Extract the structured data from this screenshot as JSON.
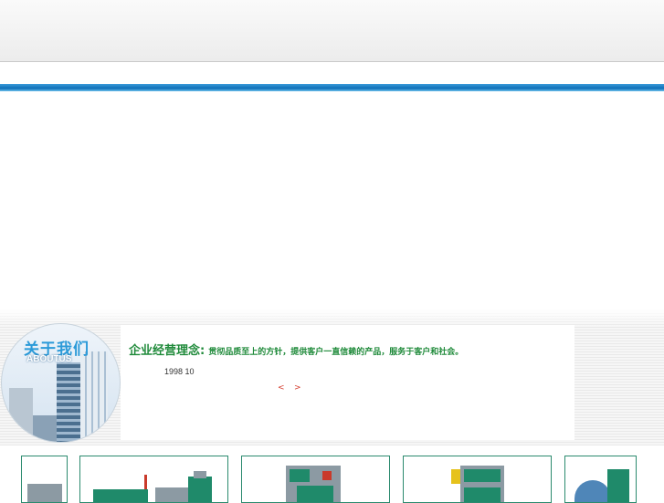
{
  "about": {
    "title": "关于我们",
    "subtitle": "ABOUTUS",
    "philosophy_label": "企业经营理念:",
    "philosophy_text": "贯彻品质至上的方针，提供客户一直信赖的产品，服务于客户和社会。",
    "founded_text": "1998  10"
  },
  "pager": {
    "prev": "<",
    "next": ">"
  },
  "colors": {
    "accent_blue": "#1077c0",
    "accent_green": "#1f8a3a",
    "card_border": "#2b8a6e",
    "arrow_red": "#d43b2c"
  },
  "products": {
    "items": [
      {
        "icon": "machine-image"
      },
      {
        "icon": "machine-image"
      },
      {
        "icon": "machine-image"
      },
      {
        "icon": "machine-image"
      },
      {
        "icon": "machine-image"
      }
    ]
  }
}
